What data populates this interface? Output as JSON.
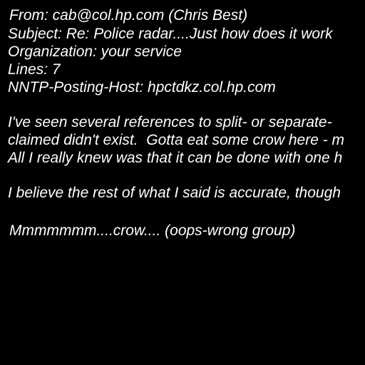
{
  "headers": {
    "from": "From: cab@col.hp.com (Chris Best)",
    "subject": "Subject: Re: Police radar....Just how does it work",
    "organization": "Organization: your service",
    "lines": "Lines: 7",
    "nntp_posting_host": "NNTP-Posting-Host: hpctdkz.col.hp.com"
  },
  "body": {
    "paragraph1": [
      "I've seen several references to split- or separate-",
      "claimed didn't exist.  Gotta eat some crow here - m",
      "All I really knew was that it can be done with one h"
    ],
    "paragraph2": "I believe the rest of what I said is accurate, though",
    "signoff": "Mmmmmmm....crow.... (oops-wrong group)"
  }
}
